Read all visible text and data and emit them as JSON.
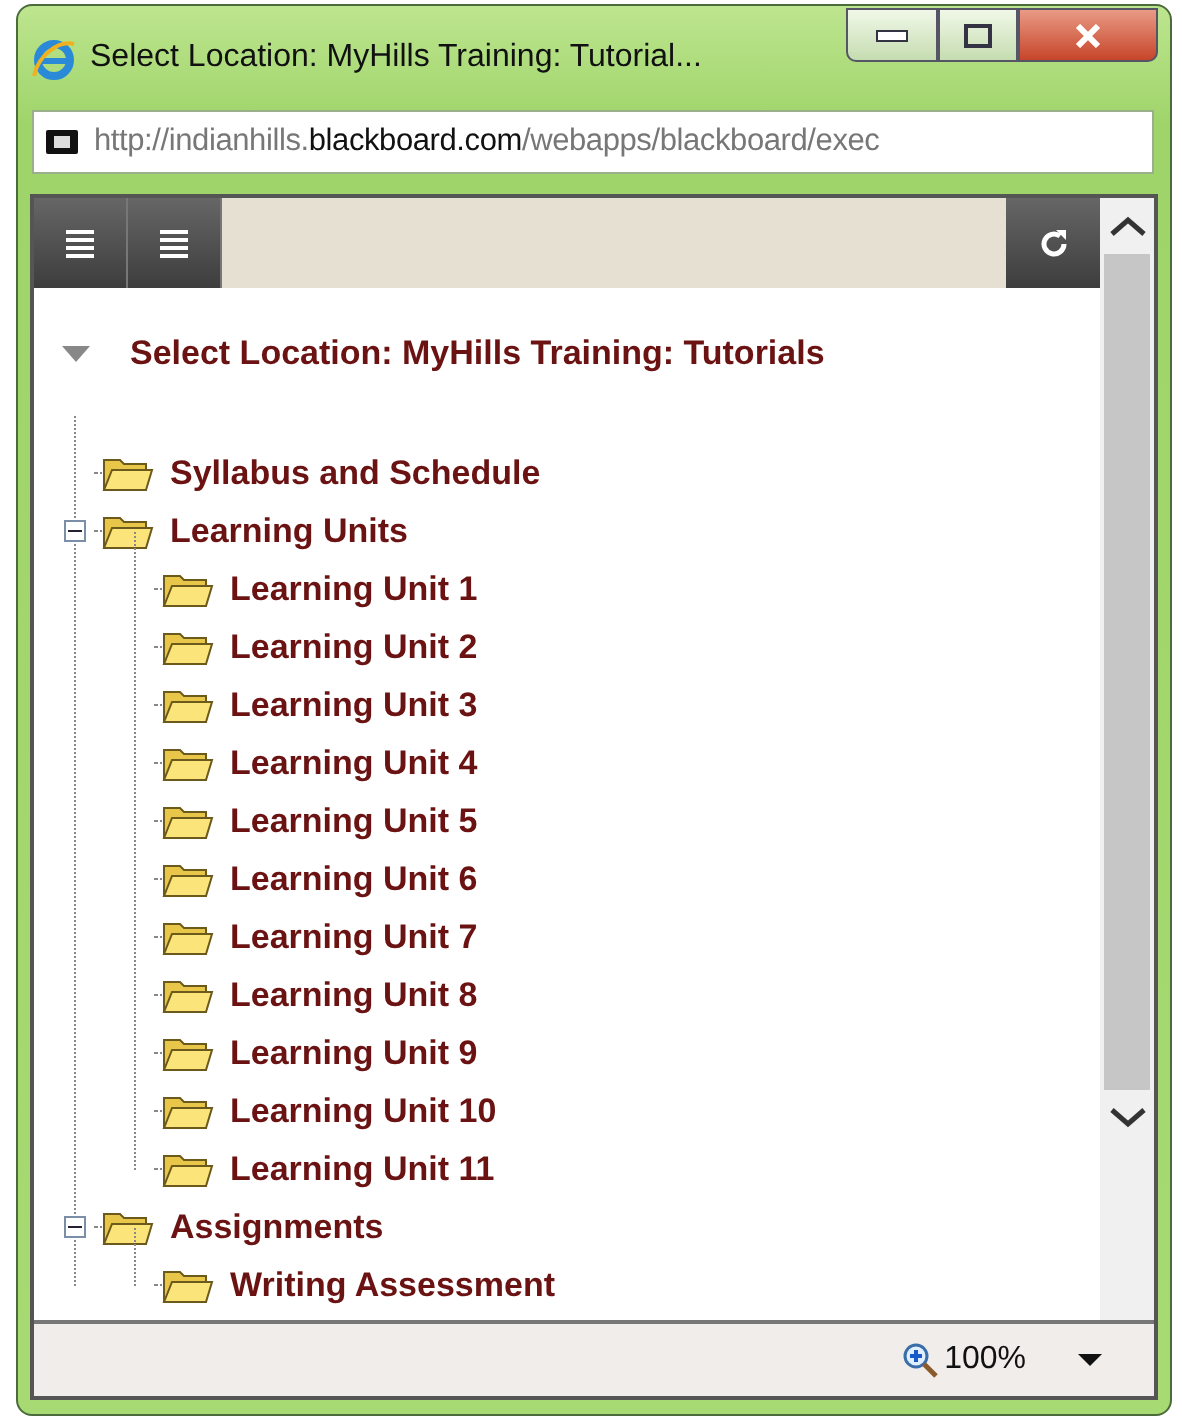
{
  "window": {
    "title": "Select Location: MyHills Training: Tutorial..."
  },
  "address_bar": {
    "url_prefix": "http://indianhills.",
    "url_domain": "blackboard.com",
    "url_path": "/webapps/blackboard/exec"
  },
  "heading": {
    "text": "Select Location: MyHills Training: Tutorials",
    "expanded": true
  },
  "tree": [
    {
      "label": "Syllabus and Schedule"
    },
    {
      "label": "Learning Units",
      "expanded": true,
      "children": [
        {
          "label": "Learning Unit 1"
        },
        {
          "label": "Learning Unit 2"
        },
        {
          "label": "Learning Unit 3"
        },
        {
          "label": "Learning Unit 4"
        },
        {
          "label": "Learning Unit 5"
        },
        {
          "label": "Learning Unit 6"
        },
        {
          "label": "Learning Unit 7"
        },
        {
          "label": "Learning Unit 8"
        },
        {
          "label": "Learning Unit 9"
        },
        {
          "label": "Learning Unit 10"
        },
        {
          "label": "Learning Unit 11"
        }
      ]
    },
    {
      "label": "Assignments",
      "expanded": true,
      "children": [
        {
          "label": "Writing Assessment"
        }
      ]
    }
  ],
  "status_bar": {
    "zoom": "100%"
  }
}
